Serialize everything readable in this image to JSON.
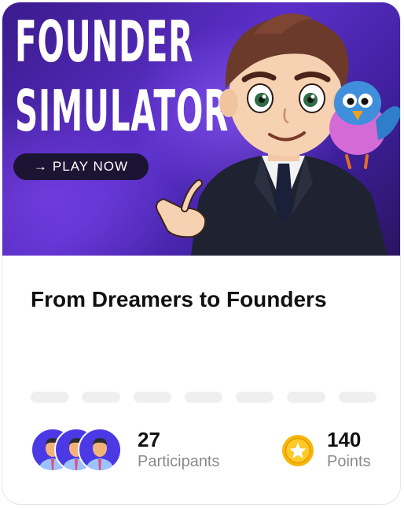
{
  "banner": {
    "title_line1": "FOUNDER",
    "title_line2": "SIMULATOR",
    "play_button_label": "PLAY NOW",
    "play_button_icon": "arrow-right-icon"
  },
  "event": {
    "title": "From Dreamers to Founders"
  },
  "progress": {
    "segments": 7,
    "completed": 0
  },
  "participants": {
    "count": "27",
    "label": "Participants",
    "avatar_icon": "person-avatar-icon"
  },
  "points": {
    "value": "140",
    "label": "Points",
    "icon": "star-coin-icon"
  },
  "colors": {
    "banner_purple": "#5a2fc8",
    "avatar_blue": "#4b39e6",
    "coin_gold": "#f5b70a",
    "progress_track": "#efefef"
  }
}
